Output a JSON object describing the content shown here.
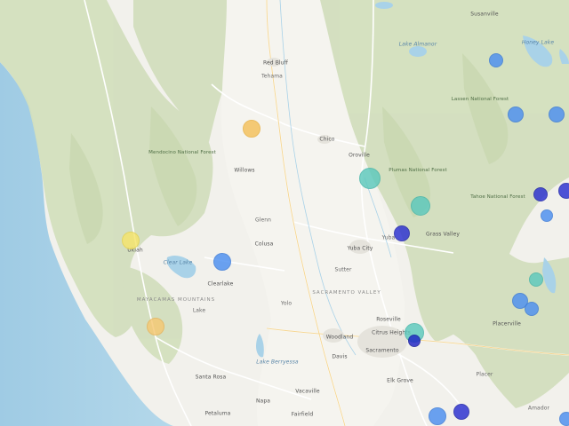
{
  "map": {
    "labels": {
      "red_bluff": "Red Bluff",
      "chico": "Chico",
      "yuba_city": "Yuba City",
      "roseville": "Roseville",
      "citrus_heights": "Citrus Heights",
      "sacramento": "Sacramento",
      "woodland": "Woodland",
      "davis": "Davis",
      "elk_grove": "Elk Grove",
      "santa_rosa": "Santa Rosa",
      "napa": "Napa",
      "vacaville": "Vacaville",
      "fairfield": "Fairfield",
      "petaluma": "Petaluma",
      "clearlake": "Clearlake",
      "ukiah": "Ukiah",
      "willows": "Willows",
      "colusa": "Colusa",
      "grass_valley": "Grass Valley",
      "oroville": "Oroville",
      "susanville": "Susanville",
      "placerville": "Placerville",
      "sacramento_valley": "SACRAMENTO VALLEY",
      "lake_almanor": "Lake Almanor",
      "honey_lake": "Honey Lake",
      "clear_lake": "Clear Lake",
      "lake_berryessa": "Lake Berryessa",
      "mendocino_nf": "Mendocino National Forest",
      "lassen_nf": "Lassen National Forest",
      "plumas_nf": "Plumas National Forest",
      "tahoe_nf": "Tahoe National Forest",
      "mayacamas": "MAYACAMAS MOUNTAINS",
      "yuba": "Yuba",
      "sutter": "Sutter",
      "tehama": "Tehama",
      "glenn": "Glenn",
      "lake": "Lake",
      "yolo": "Yolo",
      "placer": "Placer",
      "amador": "Amador"
    },
    "markers": [
      {
        "name": "marker-red-bluff-south",
        "color": "#f4c05a",
        "border": "#e8b040"
      },
      {
        "name": "marker-oroville",
        "color": "#5cc9bd",
        "border": "#45b5a9"
      },
      {
        "name": "marker-grass-valley-west",
        "color": "#5cc9bd",
        "border": "#45b5a9"
      },
      {
        "name": "marker-yuba-east",
        "color": "#2a2fd0",
        "border": "#1a1fa8"
      },
      {
        "name": "marker-ukiah",
        "color": "#f6e56b",
        "border": "#e6d350"
      },
      {
        "name": "marker-clearlake",
        "color": "#4c8ff0",
        "border": "#3a7ad8"
      },
      {
        "name": "marker-santa-rosa-north",
        "color": "#f6c873",
        "border": "#e7b45b"
      },
      {
        "name": "marker-citrus-heights",
        "color": "#5cc9bd",
        "border": "#45b5a9"
      },
      {
        "name": "marker-citrus-heights-dark",
        "color": "#1f24c6",
        "border": "#14189a"
      },
      {
        "name": "marker-east-1",
        "color": "#4c8ff0",
        "border": "#3a7ad8"
      },
      {
        "name": "marker-east-2",
        "color": "#4c8ff0",
        "border": "#3a7ad8"
      },
      {
        "name": "marker-east-3",
        "color": "#4c8ff0",
        "border": "#3a7ad8"
      },
      {
        "name": "marker-east-4",
        "color": "#2a2fd0",
        "border": "#1a1fa8"
      },
      {
        "name": "marker-east-5",
        "color": "#2a2fd0",
        "border": "#1a1fa8"
      },
      {
        "name": "marker-east-6",
        "color": "#4c8ff0",
        "border": "#3a7ad8"
      },
      {
        "name": "marker-east-7",
        "color": "#5cc9bd",
        "border": "#45b5a9"
      },
      {
        "name": "marker-east-8",
        "color": "#4c8ff0",
        "border": "#3a7ad8"
      },
      {
        "name": "marker-east-9",
        "color": "#4c8ff0",
        "border": "#3a7ad8"
      },
      {
        "name": "marker-south-1",
        "color": "#4c8ff0",
        "border": "#3a7ad8"
      },
      {
        "name": "marker-south-2",
        "color": "#2a2fd0",
        "border": "#1a1fa8"
      },
      {
        "name": "marker-south-3",
        "color": "#4c8ff0",
        "border": "#3a7ad8"
      }
    ],
    "colors": {
      "ocean": "#a9d2e8",
      "land": "#f2f1ec",
      "forest": "#cfdcb8",
      "valley": "#f4f3ee",
      "roads": "#ffffff",
      "highway": "#f6d98b"
    }
  }
}
